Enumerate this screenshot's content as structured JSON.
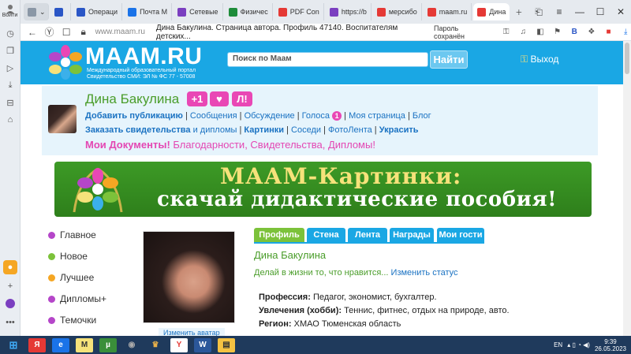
{
  "rail": {
    "login_label": "Войти"
  },
  "tabs": [
    {
      "label": "",
      "color": "#8a97a6"
    },
    {
      "label": "",
      "color": "#2a56c6"
    },
    {
      "label": "Операци",
      "color": "#2a56c6"
    },
    {
      "label": "Почта М",
      "color": "#1a73e8"
    },
    {
      "label": "Сетевые",
      "color": "#7b3fc0"
    },
    {
      "label": "Физичес",
      "color": "#1e8c3a"
    },
    {
      "label": "PDF Con",
      "color": "#e53935"
    },
    {
      "label": "https://b",
      "color": "#7b3fc0"
    },
    {
      "label": "мерсибо",
      "color": "#e53935"
    },
    {
      "label": "maam.ru",
      "color": "#e53935"
    },
    {
      "label": "Дина",
      "color": "#e53935"
    }
  ],
  "addr": {
    "url": "www.maam.ru",
    "title": "Дина Бакулина. Страница автора. Профиль 47140. Воспитателям детских...",
    "password_saved": "Пароль сохранён"
  },
  "header": {
    "brand": "MAAM.RU",
    "subtitle": "Международный образовательный портал Свидетельство СМИ: ЭЛ № ФС 77 - 57008",
    "search_placeholder": "Поиск по Маам",
    "search_button": "Найти",
    "logout": "Выход"
  },
  "profile": {
    "name": "Дина Бакулина",
    "badges": [
      "+1",
      "♥",
      "Л!"
    ],
    "links_row1": [
      "Добавить публикацию",
      "Сообщения",
      "Обсуждение",
      "Голоса",
      "Моя страница",
      "Блог"
    ],
    "votes_count": "1",
    "links_row2": [
      "Заказать свидетельства",
      "и дипломы",
      "Картинки",
      "Соседи",
      "ФотоЛента",
      "Украсить"
    ],
    "mydocs_title": "Мои Документы!",
    "mydocs_rest": "Благодарности, Свидетельства, Дипломы!"
  },
  "banner": {
    "line1": "МААМ-Картинки:",
    "line2": "скачай дидактические пособия!"
  },
  "menu": [
    {
      "label": "Главное",
      "color": "#b546c9"
    },
    {
      "label": "Новое",
      "color": "#7cc23a"
    },
    {
      "label": "Лучшее",
      "color": "#f5a623"
    },
    {
      "label": "Дипломы+",
      "color": "#b546c9"
    },
    {
      "label": "Темочки",
      "color": "#b546c9"
    }
  ],
  "photo": {
    "change_avatar": "Изменить аватар"
  },
  "profile_tabs": [
    {
      "label": "Профиль",
      "color": "#7cc23a"
    },
    {
      "label": "Стена",
      "color": "#1aa7e4"
    },
    {
      "label": "Лента",
      "color": "#1aa7e4"
    },
    {
      "label": "Награды",
      "color": "#1aa7e4"
    },
    {
      "label": "Мои гости",
      "color": "#1aa7e4"
    }
  ],
  "user": {
    "name": "Дина Бакулина",
    "status": "Делай в жизни то, что нравится...",
    "change_status": "Изменить статус",
    "profession_label": "Профессия:",
    "profession": "Педагог, экономист, бухгалтер.",
    "hobby_label": "Увлечения (хобби):",
    "hobby": "Теннис, фитнес, отдых на природе, авто.",
    "region_label": "Регион:",
    "region": "ХМАО Тюменская область"
  },
  "taskbar": {
    "lang": "EN",
    "time": "9:39",
    "date": "26.05.2023"
  }
}
